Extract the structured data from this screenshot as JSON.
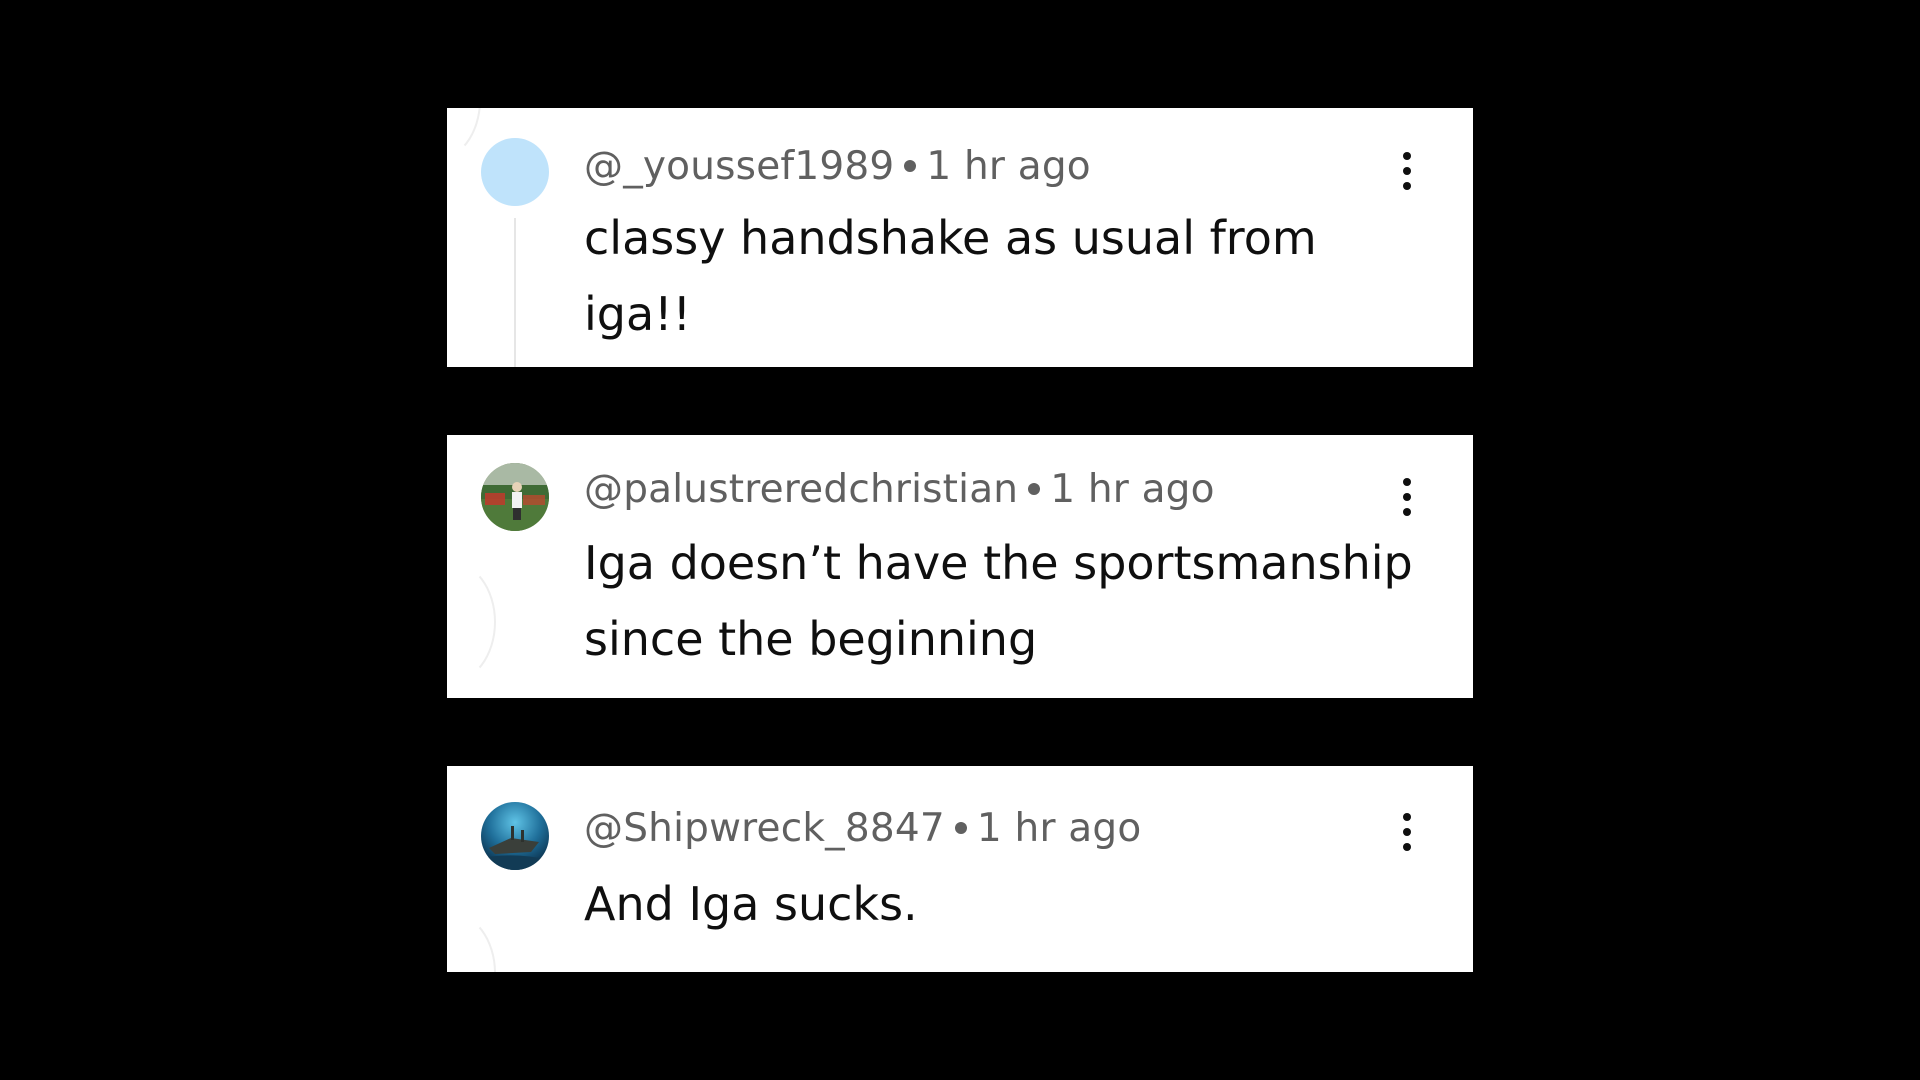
{
  "comments": [
    {
      "handle": "@_youssef1989",
      "time": "1 hr ago",
      "text": "classy handshake as usual from iga!!",
      "avatar_color": "#bfe3fb"
    },
    {
      "handle": "@palustreredchristian",
      "time": "1 hr ago",
      "text": "Iga doesn’t have the sportsmanship since the beginning"
    },
    {
      "handle": "@Shipwreck_8847",
      "time": "1 hr ago",
      "text": "And Iga sucks."
    }
  ],
  "icons": {
    "more": "more-vert-icon"
  },
  "colors": {
    "background": "#000000",
    "card": "#ffffff",
    "meta_text": "#606060",
    "body_text": "#0f0f0f"
  }
}
